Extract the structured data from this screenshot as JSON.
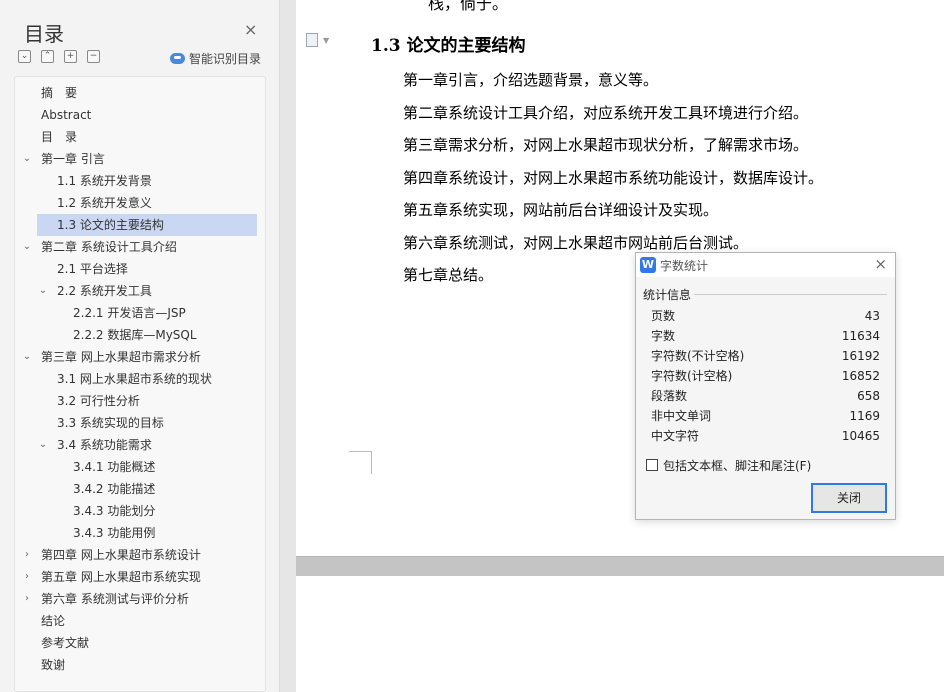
{
  "sidebar": {
    "title": "目录",
    "close_icon": "×",
    "tools": [
      "⌄",
      "⌃",
      "+",
      "−"
    ],
    "smart_label": "智能识别目录",
    "toc": [
      {
        "label": "摘　要",
        "level": 0,
        "expand": null,
        "active": false
      },
      {
        "label": "Abstract",
        "level": 0,
        "expand": null,
        "active": false
      },
      {
        "label": "目　录",
        "level": 0,
        "expand": null,
        "active": false
      },
      {
        "label": "第一章 引言",
        "level": 0,
        "expand": "open",
        "active": false
      },
      {
        "label": "1.1  系统开发背景",
        "level": 1,
        "expand": null,
        "active": false
      },
      {
        "label": "1.2  系统开发意义",
        "level": 1,
        "expand": null,
        "active": false
      },
      {
        "label": "1.3 论文的主要结构",
        "level": 1,
        "expand": null,
        "active": true
      },
      {
        "label": "第二章 系统设计工具介绍",
        "level": 0,
        "expand": "open",
        "active": false
      },
      {
        "label": "2.1  平台选择",
        "level": 1,
        "expand": null,
        "active": false
      },
      {
        "label": "2.2  系统开发工具",
        "level": 1,
        "expand": "open",
        "active": false
      },
      {
        "label": "2.2.1  开发语言—JSP",
        "level": 2,
        "expand": null,
        "active": false
      },
      {
        "label": "2.2.2  数据库—MySQL",
        "level": 2,
        "expand": null,
        "active": false
      },
      {
        "label": "第三章 网上水果超市需求分析",
        "level": 0,
        "expand": "open",
        "active": false
      },
      {
        "label": "3.1  网上水果超市系统的现状",
        "level": 1,
        "expand": null,
        "active": false
      },
      {
        "label": "3.2  可行性分析",
        "level": 1,
        "expand": null,
        "active": false
      },
      {
        "label": "3.3  系统实现的目标",
        "level": 1,
        "expand": null,
        "active": false
      },
      {
        "label": "3.4  系统功能需求",
        "level": 1,
        "expand": "open",
        "active": false
      },
      {
        "label": "3.4.1  功能概述",
        "level": 2,
        "expand": null,
        "active": false
      },
      {
        "label": "3.4.2  功能描述",
        "level": 2,
        "expand": null,
        "active": false
      },
      {
        "label": "3.4.3  功能划分",
        "level": 2,
        "expand": null,
        "active": false
      },
      {
        "label": "3.4.3  功能用例",
        "level": 2,
        "expand": null,
        "active": false
      },
      {
        "label": "第四章 网上水果超市系统设计",
        "level": 0,
        "expand": "closed",
        "active": false
      },
      {
        "label": "第五章 网上水果超市系统实现",
        "level": 0,
        "expand": "closed",
        "active": false
      },
      {
        "label": "第六章 系统测试与评价分析",
        "level": 0,
        "expand": "closed",
        "active": false
      },
      {
        "label": "结论",
        "level": 0,
        "expand": null,
        "active": false
      },
      {
        "label": "参考文献",
        "level": 0,
        "expand": null,
        "active": false
      },
      {
        "label": "致谢",
        "level": 0,
        "expand": null,
        "active": false
      }
    ]
  },
  "document": {
    "clipped_top": "栈，倘于。",
    "heading": "1.3 论文的主要结构",
    "paragraphs": [
      "第一章引言，介绍选题背景，意义等。",
      "第二章系统设计工具介绍，对应系统开发工具环境进行介绍。",
      "第三章需求分析，对网上水果超市现状分析，了解需求市场。",
      "第四章系统设计，对网上水果超市系统功能设计，数据库设计。",
      "第五章系统实现，网站前后台详细设计及实现。",
      "第六章系统测试，对网上水果超市网站前后台测试。",
      "第七章总结。"
    ]
  },
  "dialog": {
    "logo": "W",
    "title": "字数统计",
    "close_icon": "×",
    "group_label": "统计信息",
    "stats": [
      {
        "label": "页数",
        "value": "43"
      },
      {
        "label": "字数",
        "value": "11634"
      },
      {
        "label": "字符数(不计空格)",
        "value": "16192"
      },
      {
        "label": "字符数(计空格)",
        "value": "16852"
      },
      {
        "label": "段落数",
        "value": "658"
      },
      {
        "label": "非中文单词",
        "value": "1169"
      },
      {
        "label": "中文字符",
        "value": "10465"
      }
    ],
    "checkbox_label": "包括文本框、脚注和尾注(F)",
    "checkbox_checked": false,
    "close_button": "关闭"
  }
}
